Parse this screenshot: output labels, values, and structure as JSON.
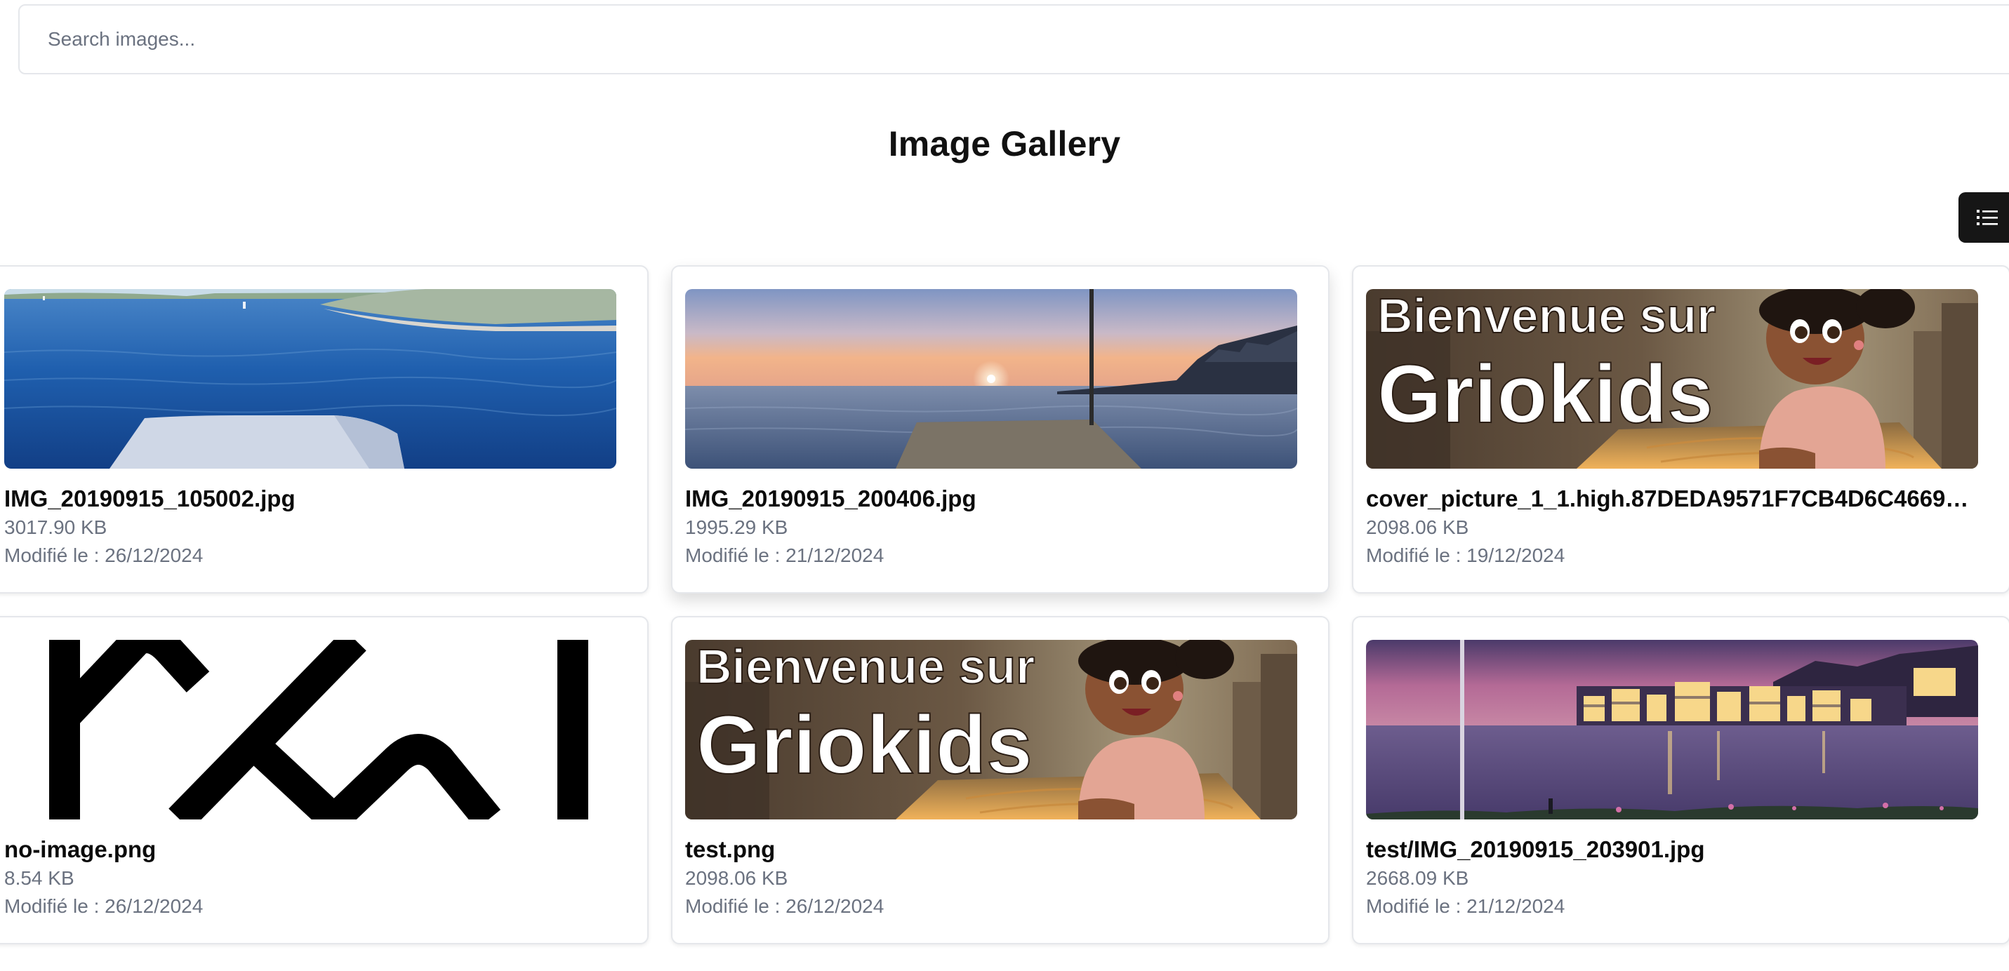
{
  "search": {
    "placeholder": "Search images..."
  },
  "header": {
    "title": "Image Gallery"
  },
  "toolbar": {
    "view_toggle_icon": "list-icon"
  },
  "images": [
    {
      "name": "IMG_20190915_105002.jpg",
      "size": "3017.90 KB",
      "modified": "Modifié le : 26/12/2024",
      "preview": "harbor-photo"
    },
    {
      "name": "IMG_20190915_200406.jpg",
      "size": "1995.29 KB",
      "modified": "Modifié le : 21/12/2024",
      "preview": "sunset-photo"
    },
    {
      "name": "cover_picture_1_1.high.87DEDA9571F7CB4D6C4669F7…",
      "size": "2098.06 KB",
      "modified": "Modifié le : 19/12/2024",
      "preview": "griokids-banner",
      "banner_text": [
        "Bienvenue sur",
        "Griokids"
      ]
    },
    {
      "name": "no-image.png",
      "size": "8.54 KB",
      "modified": "Modifié le : 26/12/2024",
      "preview": "no-image-logo"
    },
    {
      "name": "test.png",
      "size": "2098.06 KB",
      "modified": "Modifié le : 26/12/2024",
      "preview": "griokids-banner",
      "banner_text": [
        "Bienvenue sur",
        "Griokids"
      ]
    },
    {
      "name": "test/IMG_20190915_203901.jpg",
      "size": "2668.09 KB",
      "modified": "Modifié le : 21/12/2024",
      "preview": "night-city-photo"
    }
  ],
  "colors": {
    "toggle_bg": "#161616",
    "card_border": "#e5e7eb",
    "muted_text": "#6b7280"
  }
}
